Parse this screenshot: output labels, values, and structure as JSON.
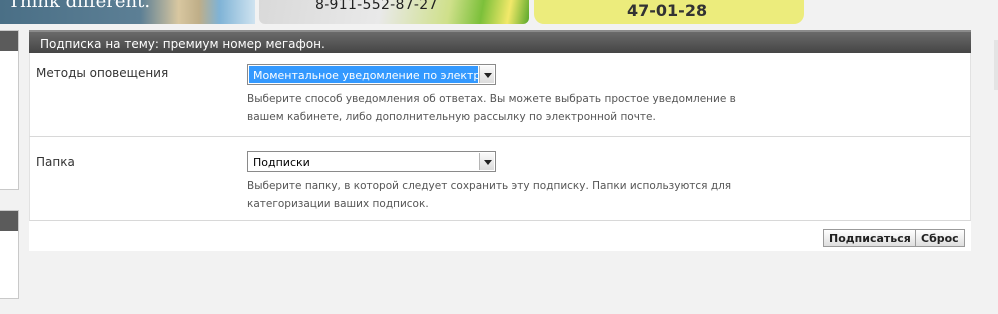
{
  "banners": {
    "first_text": "Think different.",
    "second_phone": "8-911-552-87-27",
    "third_phone": "47-01-28"
  },
  "panel": {
    "title": "Подписка на тему: премиум номер мегафон."
  },
  "notify": {
    "label": "Методы оповещения",
    "selected": "Моментальное уведомление по электронной",
    "description": "Выберите способ уведомления об ответах. Вы можете выбрать простое уведомление в вашем кабинете, либо дополнительную рассылку по электронной почте."
  },
  "folder": {
    "label": "Папка",
    "selected": "Подписки",
    "description": "Выберите папку, в которой следует сохранить эту подписку. Папки используются для категоризации ваших подписок."
  },
  "actions": {
    "subscribe_label": "Подписаться",
    "reset_label": "Сброс"
  },
  "colors": {
    "header_bg": "#4f4f4f",
    "select_highlight": "#3399ff",
    "phone_banner": "#ecec7c"
  }
}
